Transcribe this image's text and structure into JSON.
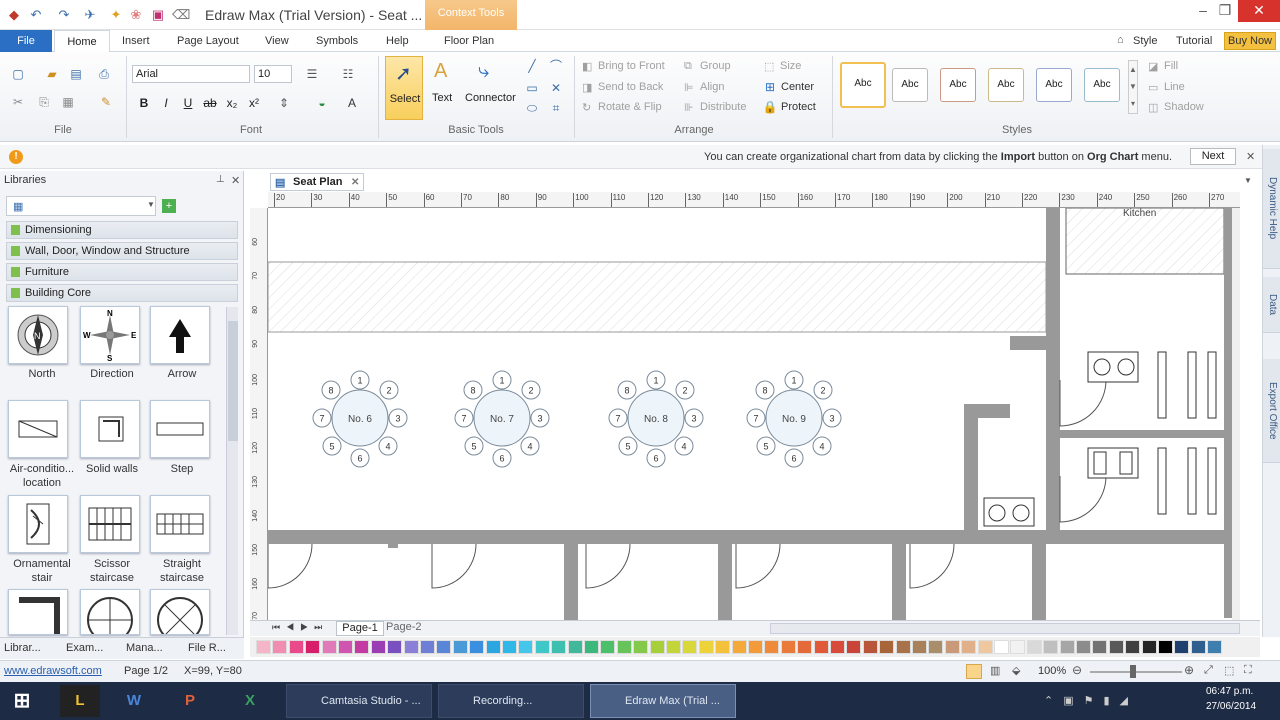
{
  "window": {
    "title": "Edraw Max (Trial Version) - Seat ...",
    "context_tab": "Context Tools"
  },
  "quick_access": [
    "save-icon",
    "undo-icon",
    "redo-icon",
    "share-icon",
    "paint-icon",
    "gift-icon",
    "image-icon",
    "clear-icon"
  ],
  "menu": {
    "file": "File",
    "tabs": [
      "Home",
      "Insert",
      "Page Layout",
      "View",
      "Symbols",
      "Help",
      "Floor Plan"
    ],
    "right": [
      "Style",
      "Tutorial"
    ],
    "buy": "Buy Now"
  },
  "ribbon": {
    "groups": {
      "file": "File",
      "font": "Font",
      "basic_tools": "Basic Tools",
      "arrange": "Arrange",
      "styles": "Styles"
    },
    "font": {
      "family": "Arial",
      "size": "10"
    },
    "tools": {
      "select": "Select",
      "text": "Text",
      "connector": "Connector"
    },
    "arrange": {
      "bring_front": "Bring to Front",
      "send_back": "Send to Back",
      "rotate": "Rotate & Flip",
      "group": "Group",
      "align": "Align",
      "distribute": "Distribute",
      "size": "Size",
      "center": "Center",
      "protect": "Protect"
    },
    "style_box_label": "Abc",
    "format": {
      "fill": "Fill",
      "line": "Line",
      "shadow": "Shadow"
    }
  },
  "infobar": {
    "pre": "You can create organizational chart from data by clicking the",
    "import": "Import",
    "mid": "button on",
    "org": "Org Chart",
    "post": "menu.",
    "next": "Next"
  },
  "libraries": {
    "title": "Libraries",
    "categories": [
      "Dimensioning",
      "Wall, Door, Window and Structure",
      "Furniture",
      "Building Core"
    ],
    "shapes": [
      {
        "label": "North",
        "label2": ""
      },
      {
        "label": "Direction",
        "label2": ""
      },
      {
        "label": "Arrow",
        "label2": ""
      },
      {
        "label": "Air-conditio...",
        "label2": "location"
      },
      {
        "label": "Solid walls",
        "label2": ""
      },
      {
        "label": "Step",
        "label2": ""
      },
      {
        "label": "Ornamental",
        "label2": "stair"
      },
      {
        "label": "Scissor",
        "label2": "staircase"
      },
      {
        "label": "Straight",
        "label2": "staircase"
      }
    ],
    "compass": {
      "n": "N",
      "s": "S",
      "e": "E",
      "w": "W"
    },
    "bottom_tabs": [
      "Librar...",
      "Exam...",
      "Mana...",
      "File R..."
    ]
  },
  "document": {
    "tab": "Seat Plan",
    "pages": [
      "Page-1",
      "Page-2"
    ],
    "top_label": "Kitchen"
  },
  "ruler": {
    "top": [
      "20",
      "30",
      "40",
      "50",
      "60",
      "70",
      "80",
      "90",
      "100",
      "110",
      "120",
      "130",
      "140",
      "150",
      "160",
      "170",
      "180",
      "190",
      "200",
      "210",
      "220",
      "230",
      "240",
      "250",
      "260",
      "270"
    ],
    "left": [
      "60",
      "70",
      "80",
      "90",
      "100",
      "110",
      "120",
      "130",
      "140",
      "150",
      "160",
      "170"
    ]
  },
  "tables": [
    {
      "label": "No. 6",
      "seats": [
        "1",
        "2",
        "3",
        "4",
        "5",
        "6",
        "7",
        "8"
      ]
    },
    {
      "label": "No. 7",
      "seats": [
        "1",
        "2",
        "3",
        "4",
        "5",
        "6",
        "7",
        "8"
      ]
    },
    {
      "label": "No. 8",
      "seats": [
        "1",
        "2",
        "3",
        "4",
        "5",
        "6",
        "7",
        "8"
      ]
    },
    {
      "label": "No. 9",
      "seats": [
        "1",
        "2",
        "3",
        "4",
        "5",
        "6",
        "7",
        "8"
      ]
    }
  ],
  "side_tabs": [
    "Dynamic Help",
    "Data",
    "Export Office"
  ],
  "palette": [
    "#f5b5c8",
    "#f08db0",
    "#e84a8a",
    "#d81e6a",
    "#e07ab8",
    "#d055b0",
    "#c43aa3",
    "#9b3db3",
    "#7a4fc0",
    "#8b80d8",
    "#6f7fd6",
    "#5a86d8",
    "#4a9ad8",
    "#3a8fe0",
    "#2ba6e0",
    "#2fb7e8",
    "#46c6ea",
    "#40c8c8",
    "#3ec0b0",
    "#41b89a",
    "#3cb87c",
    "#4cbf6a",
    "#66c45a",
    "#85c94a",
    "#a6cf3a",
    "#c2d63a",
    "#d9d83a",
    "#eed23a",
    "#f3c23a",
    "#f4aa3a",
    "#f39a3a",
    "#ef8a3a",
    "#ea7a3a",
    "#e46a3a",
    "#e05a3a",
    "#d84a3a",
    "#c9453a",
    "#b9553a",
    "#a9653a",
    "#a8734a",
    "#a8805a",
    "#a88e6a",
    "#c89a7a",
    "#e0b08a",
    "#f0c8a0",
    "#ffffff",
    "#f2f2f2",
    "#d9d9d9",
    "#bfbfbf",
    "#a6a6a6",
    "#8c8c8c",
    "#737373",
    "#595959",
    "#404040",
    "#262626",
    "#000000",
    "#1f3f6f",
    "#2f5f8f",
    "#3f7faf"
  ],
  "status": {
    "link": "www.edrawsoft.com",
    "page": "Page 1/2",
    "coords": "X=99, Y=80",
    "zoom": "100%"
  },
  "taskbar": {
    "buttons": [
      "Camtasia Studio - ...",
      "Recording...",
      "Edraw Max (Trial ..."
    ],
    "time": "06:47 p.m.",
    "date": "27/06/2014"
  }
}
